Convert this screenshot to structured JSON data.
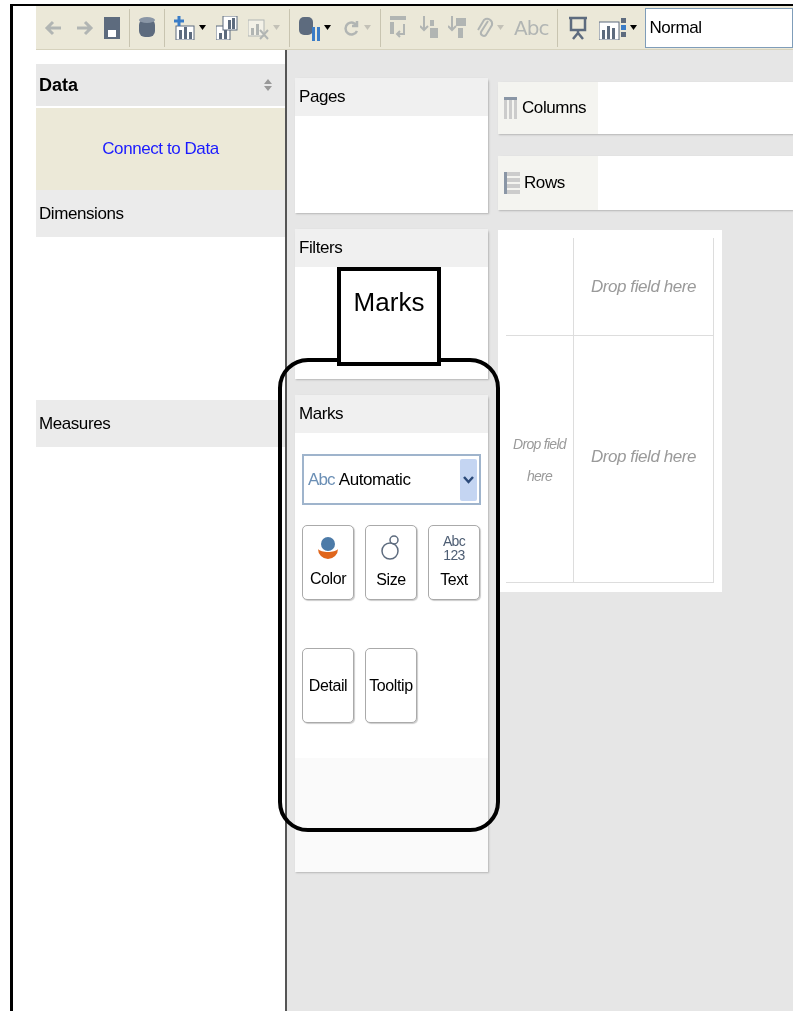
{
  "toolbar": {
    "items": [
      {
        "kind": "back",
        "disabled": true,
        "has_menu": false
      },
      {
        "kind": "forward",
        "disabled": true,
        "has_menu": false
      },
      {
        "kind": "save",
        "disabled": false,
        "has_menu": false
      },
      {
        "kind": "separator"
      },
      {
        "kind": "database",
        "disabled": false,
        "has_menu": false
      },
      {
        "kind": "separator"
      },
      {
        "kind": "new-sheet",
        "disabled": false,
        "has_menu": true
      },
      {
        "kind": "duplicate-chart",
        "disabled": false,
        "has_menu": false
      },
      {
        "kind": "clear-chart",
        "disabled": true,
        "has_menu": true
      },
      {
        "kind": "separator"
      },
      {
        "kind": "data-source",
        "disabled": false,
        "has_menu": true
      },
      {
        "kind": "refresh",
        "disabled": true,
        "has_menu": true
      },
      {
        "kind": "separator"
      },
      {
        "kind": "swap",
        "disabled": true,
        "has_menu": false
      },
      {
        "kind": "sort-ascending",
        "disabled": true,
        "has_menu": false
      },
      {
        "kind": "sort-descending",
        "disabled": true,
        "has_menu": false
      },
      {
        "kind": "paperclip",
        "disabled": true,
        "has_menu": true
      },
      {
        "kind": "label",
        "text": "Abc",
        "disabled": true,
        "has_menu": false
      },
      {
        "kind": "separator"
      },
      {
        "kind": "presentation",
        "disabled": false,
        "has_menu": false
      },
      {
        "kind": "show-me",
        "disabled": false,
        "has_menu": true
      }
    ],
    "view_field": {
      "value": "Normal"
    }
  },
  "data_panel": {
    "title": "Data",
    "connect_link": "Connect to Data",
    "sections": [
      "Dimensions",
      "Measures"
    ]
  },
  "cards": [
    {
      "title": "Pages"
    },
    {
      "title": "Filters"
    }
  ],
  "marks_card": {
    "title": "Marks",
    "mark_type": {
      "icon_text": "Abc",
      "value": "Automatic"
    },
    "buttons": [
      {
        "kind": "color",
        "label": "Color"
      },
      {
        "kind": "size",
        "label": "Size"
      },
      {
        "kind": "text",
        "label": "Text",
        "icon_lines": [
          "Abc",
          "123"
        ]
      },
      {
        "kind": "detail",
        "label": "Detail"
      },
      {
        "kind": "tooltip",
        "label": "Tooltip"
      }
    ]
  },
  "shelves": [
    {
      "kind": "columns",
      "label": "Columns"
    },
    {
      "kind": "rows",
      "label": "Rows"
    }
  ],
  "view_grid": {
    "top": "Drop field here",
    "left": "Drop field here",
    "center": "Drop field here"
  },
  "annotation": {
    "callout": "Marks"
  }
}
